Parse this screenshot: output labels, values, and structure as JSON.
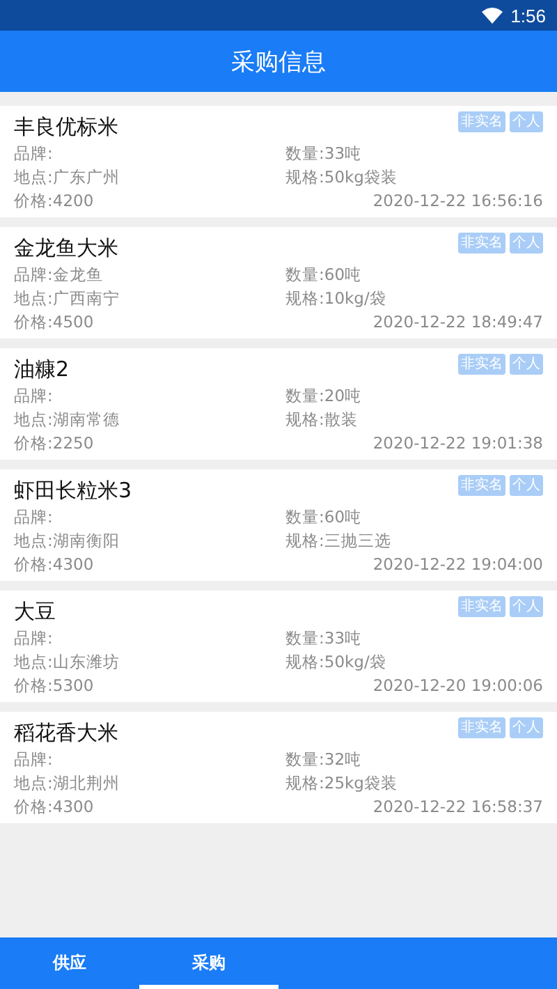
{
  "status_bar": {
    "time": "1:56"
  },
  "header": {
    "title": "采购信息"
  },
  "listings": [
    {
      "title": "丰良优标米",
      "tags": [
        "非实名",
        "个人"
      ],
      "brand": "品牌:",
      "quantity": "数量:33吨",
      "location": "地点:广东广州",
      "spec": "规格:50kg袋装",
      "price": "价格:4200",
      "date": "2020-12-22 16:56:16"
    },
    {
      "title": "金龙鱼大米",
      "tags": [
        "非实名",
        "个人"
      ],
      "brand": "品牌:金龙鱼",
      "quantity": "数量:60吨",
      "location": "地点:广西南宁",
      "spec": "规格:10kg/袋",
      "price": "价格:4500",
      "date": "2020-12-22 18:49:47"
    },
    {
      "title": "油糠2",
      "tags": [
        "非实名",
        "个人"
      ],
      "brand": "品牌:",
      "quantity": "数量:20吨",
      "location": "地点:湖南常德",
      "spec": "规格:散装",
      "price": "价格:2250",
      "date": "2020-12-22 19:01:38"
    },
    {
      "title": "虾田长粒米3",
      "tags": [
        "非实名",
        "个人"
      ],
      "brand": "品牌:",
      "quantity": "数量:60吨",
      "location": "地点:湖南衡阳",
      "spec": "规格:三抛三选",
      "price": "价格:4300",
      "date": "2020-12-22 19:04:00"
    },
    {
      "title": "大豆",
      "tags": [
        "非实名",
        "个人"
      ],
      "brand": "品牌:",
      "quantity": "数量:33吨",
      "location": "地点:山东潍坊",
      "spec": "规格:50kg/袋",
      "price": "价格:5300",
      "date": "2020-12-20 19:00:06"
    },
    {
      "title": "稻花香大米",
      "tags": [
        "非实名",
        "个人"
      ],
      "brand": "品牌:",
      "quantity": "数量:32吨",
      "location": "地点:湖北荆州",
      "spec": "规格:25kg袋装",
      "price": "价格:4300",
      "date": "2020-12-22 16:58:37"
    }
  ],
  "tabs": [
    {
      "label": "供应",
      "selected": false
    },
    {
      "label": "采购",
      "selected": true
    }
  ]
}
